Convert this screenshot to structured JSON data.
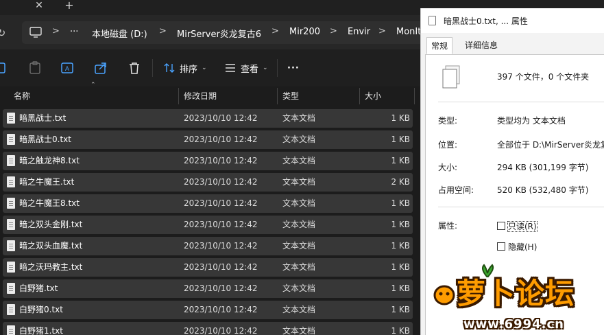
{
  "tabbar": {
    "close_glyph": "✕",
    "new_tab_glyph": "+"
  },
  "address": {
    "refresh_glyph": "↻",
    "ellipsis": "···",
    "crumbs": [
      "本地磁盘 (D:)",
      "MirServer炎龙复古6",
      "Mir200",
      "Envir",
      "MonIt"
    ],
    "separator": ">"
  },
  "toolbar": {
    "sort_label": "排序",
    "view_label": "查看",
    "more_label": "···"
  },
  "columns": {
    "name": "名称",
    "date": "修改日期",
    "type": "类型",
    "size": "大小"
  },
  "files": [
    {
      "name": "暗黑战士.txt",
      "date": "2023/10/10 12:42",
      "type": "文本文档",
      "size": "1 KB"
    },
    {
      "name": "暗黑战士0.txt",
      "date": "2023/10/10 12:42",
      "type": "文本文档",
      "size": "1 KB"
    },
    {
      "name": "暗之触龙神8.txt",
      "date": "2023/10/10 12:42",
      "type": "文本文档",
      "size": "1 KB"
    },
    {
      "name": "暗之牛魔王.txt",
      "date": "2023/10/10 12:42",
      "type": "文本文档",
      "size": "2 KB"
    },
    {
      "name": "暗之牛魔王8.txt",
      "date": "2023/10/10 12:42",
      "type": "文本文档",
      "size": "1 KB"
    },
    {
      "name": "暗之双头金刚.txt",
      "date": "2023/10/10 12:42",
      "type": "文本文档",
      "size": "1 KB"
    },
    {
      "name": "暗之双头血魔.txt",
      "date": "2023/10/10 12:42",
      "type": "文本文档",
      "size": "1 KB"
    },
    {
      "name": "暗之沃玛教主.txt",
      "date": "2023/10/10 12:42",
      "type": "文本文档",
      "size": "1 KB"
    },
    {
      "name": "白野猪.txt",
      "date": "2023/10/10 12:42",
      "type": "文本文档",
      "size": "1 KB"
    },
    {
      "name": "白野猪0.txt",
      "date": "2023/10/10 12:42",
      "type": "文本文档",
      "size": "1 KB"
    },
    {
      "name": "白野猪1.txt",
      "date": "2023/10/10 12:42",
      "type": "文本文档",
      "size": "1 KB"
    }
  ],
  "dialog": {
    "title": "暗黑战士0.txt, ... 属性",
    "tabs": [
      "常规",
      "详细信息"
    ],
    "summary": "397 个文件，0 个文件夹",
    "type_label": "类型:",
    "type_value": "类型均为 文本文档",
    "location_label": "位置:",
    "location_value": "全部位于 D:\\MirServer炎龙复",
    "size_label": "大小:",
    "size_value": "294 KB (301,199 字节)",
    "disk_label": "占用空间:",
    "disk_value": "520 KB (532,480 字节)",
    "attr_label": "属性:",
    "readonly_label": "只读(R)",
    "hidden_label": "隐藏(H)"
  },
  "watermark": {
    "logo_text": "萝卜论坛",
    "url": "www.6994.cn"
  }
}
